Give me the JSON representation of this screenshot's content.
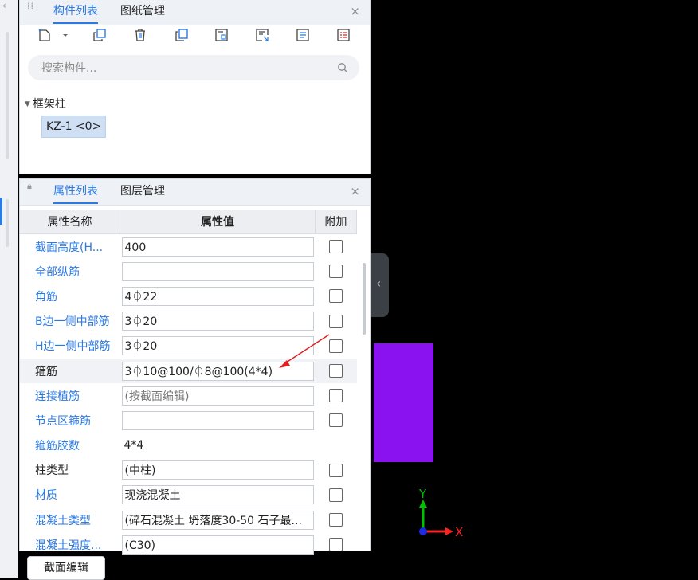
{
  "left_strip": {
    "chevron": "‹"
  },
  "top_panel": {
    "tabs": [
      {
        "label": "构件列表",
        "active": true
      },
      {
        "label": "图纸管理",
        "active": false
      }
    ],
    "close": "×",
    "toolbar_icons": [
      "new-component-icon",
      "dropdown-icon",
      "copy-icon",
      "delete-icon",
      "copy-layer-icon",
      "save-template-icon",
      "import-icon",
      "text-icon",
      "list-icon"
    ],
    "search": {
      "placeholder": "搜索构件..."
    },
    "tree": {
      "group": "框架柱",
      "items": [
        {
          "label": "KZ-1 <0>"
        }
      ]
    }
  },
  "prop_panel": {
    "tabs": [
      {
        "label": "属性列表",
        "active": true
      },
      {
        "label": "图层管理",
        "active": false
      }
    ],
    "close": "×",
    "headers": {
      "name": "属性名称",
      "value": "属性值",
      "extra": "附加"
    },
    "rows": [
      {
        "name": "截面高度(H...",
        "value": "400",
        "checkbox": true
      },
      {
        "name": "全部纵筋",
        "value": "",
        "checkbox": true
      },
      {
        "name": "角筋",
        "value": "4⏀22",
        "checkbox": true
      },
      {
        "name": "B边一侧中部筋",
        "value": "3⏀20",
        "checkbox": true
      },
      {
        "name": "H边一侧中部筋",
        "value": "3⏀20",
        "checkbox": true
      },
      {
        "name": "箍筋",
        "value": "3⏀10@100/⏀8@100(4*4)",
        "checkbox": true
      },
      {
        "name": "连接植筋",
        "value": "(按截面编辑)",
        "checkbox": true
      },
      {
        "name": "节点区箍筋",
        "value": "",
        "checkbox": true
      },
      {
        "name": "箍筋胶数",
        "value": "4*4",
        "checkbox": false
      },
      {
        "name": "柱类型",
        "value": "(中柱)",
        "checkbox": true
      },
      {
        "name": "材质",
        "value": "现浇混凝土",
        "checkbox": true
      },
      {
        "name": "混凝土类型",
        "value": "(碎石混凝土 坍落度30-50 石子最...",
        "checkbox": true
      },
      {
        "name": "混凝土强度...",
        "value": "(C30)",
        "checkbox": true
      }
    ],
    "button": "截面编辑"
  },
  "canvas": {
    "collapse_handle": "‹",
    "axis": {
      "y": "Y",
      "x": "X"
    },
    "colors": {
      "shape": "#8a11f0",
      "y_axis": "#00c000",
      "x_axis": "#ff2020",
      "origin": "#1a2be0",
      "annotation_arrow": "#e02020"
    }
  }
}
